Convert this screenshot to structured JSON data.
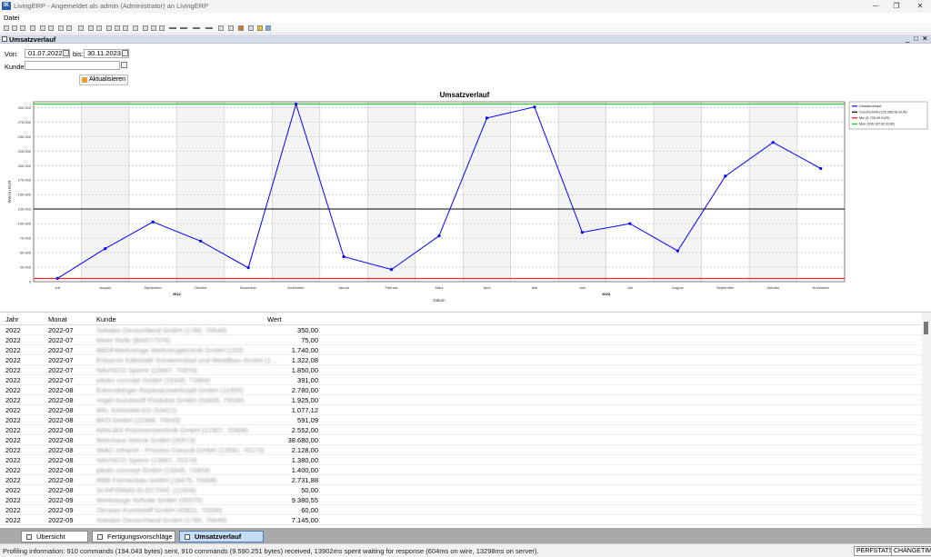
{
  "window": {
    "title": "LivingERP - Angemeldet als admin (Administrator) an LivingERP",
    "app_icon": "IK"
  },
  "menu": {
    "items": [
      "Datei"
    ]
  },
  "document": {
    "title": "Umsatzverlauf"
  },
  "filters": {
    "from_label": "Von:",
    "from_value": "01.07.2022",
    "to_label": "bis:",
    "to_value": "30.11.2023",
    "customer_label": "Kunde:",
    "customer_value": "",
    "refresh_label": "Aktualisieren"
  },
  "chart_data": {
    "type": "line",
    "title": "Umsatzverlauf",
    "ylabel": "Wert in EUR",
    "xlabel": "Datum",
    "ylim": [
      0,
      310000
    ],
    "yticks": [
      0,
      25000,
      50000,
      75000,
      100000,
      125000,
      150000,
      175000,
      200000,
      225000,
      250000,
      275000,
      300000
    ],
    "ytick_labels": [
      "0",
      "25.000",
      "50.000",
      "75.000",
      "100.000",
      "125.000",
      "150.000",
      "175.000",
      "200.000",
      "225.000",
      "250.000",
      "275.000",
      "300.000"
    ],
    "categories": [
      "Juli",
      "August",
      "September",
      "Oktober",
      "November",
      "Dezember",
      "Januar",
      "Februar",
      "März",
      "April",
      "Mai",
      "Juni",
      "Juli",
      "August",
      "September",
      "Oktober",
      "November"
    ],
    "year_labels": [
      {
        "label": "2022",
        "at": 2.5
      },
      {
        "label": "2023",
        "at": 11.5
      }
    ],
    "series": [
      {
        "name": "Umsatzverlauf",
        "color": "#0000ff",
        "values": [
          5700,
          57000,
          103000,
          70000,
          24000,
          306000,
          43000,
          21000,
          79000,
          282000,
          301000,
          85000,
          100000,
          53000,
          182000,
          240000,
          195000
        ]
      }
    ],
    "reference_lines": [
      {
        "name": "Durchschnitt (125.285,08 EUR)",
        "value": 125285.08,
        "color": "#000000"
      },
      {
        "name": "Min (5.728,09 EUR)",
        "value": 5728.09,
        "color": "#ff0000"
      },
      {
        "name": "Max (306.187,80 EUR)",
        "value": 306187.8,
        "color": "#00cc00"
      }
    ],
    "legend_position": "right",
    "grid": true
  },
  "table": {
    "columns": [
      "Jahr",
      "Monat",
      "Kunde",
      "Wert"
    ],
    "rows": [
      [
        "2022",
        "2022-07",
        "Sekalon Deutschland GmbH (1780, 70649)",
        "350,00"
      ],
      [
        "2022",
        "2022-07",
        "Meier Rolle (BHS77376)",
        "75,00"
      ],
      [
        "2022",
        "2022-07",
        "BBDFWerkzeuge Werkzeugtechnik GmbH (1105…",
        "1.740,00"
      ],
      [
        "2022",
        "2022-07",
        "Erbsenm Edelstahl Schwimmbad und Metallbau GmbH (1…",
        "1.322,08"
      ],
      [
        "2022",
        "2022-07",
        "NAVISCO Sperre (13847, 70374)",
        "1.850,00"
      ],
      [
        "2022",
        "2022-07",
        "pikatu concept GmbH (19345, 73454)",
        "391,00"
      ],
      [
        "2022",
        "2022-08",
        "Erkensberger Reparaturwerkstatt GmbH (11955)",
        "2.780,00"
      ],
      [
        "2022",
        "2022-08",
        "Vogel Kunststoff Produkte GmbH (53435, 79035)",
        "1.925,00"
      ],
      [
        "2022",
        "2022-08",
        "BRL KANAMA KG (53421)",
        "1.077,12"
      ],
      [
        "2022",
        "2022-08",
        "BKO GmbH (12396, 70045)",
        "591,09"
      ],
      [
        "2022",
        "2022-08",
        "NANJAS Präzisionstechnik GmbH (12307, 70458)",
        "2.552,00"
      ],
      [
        "2022",
        "2022-08",
        "Weinhaus Sterne GmbH (30573)",
        "38.680,00"
      ],
      [
        "2022",
        "2022-08",
        "IWAC Infranet - Process Consult GmbH (13581, 70173)",
        "2.128,00"
      ],
      [
        "2022",
        "2022-08",
        "NAVISCO Sperre (13847, 70374)",
        "1.380,00"
      ],
      [
        "2022",
        "2022-08",
        "pikatu concept GmbH (19345, 73454)",
        "1.400,00"
      ],
      [
        "2022",
        "2022-08",
        "RBB Formenbau GmbH (18475, 70068)",
        "2.731,88"
      ],
      [
        "2022",
        "2022-08",
        "SUNFORMS ELECTRIC (11504)",
        "50,00"
      ],
      [
        "2022",
        "2022-09",
        "Werkzeuge Schulte GmbH (30575)",
        "9.380,55"
      ],
      [
        "2022",
        "2022-09",
        "Zitrusan Kunststoff GmbH (43811, 70346)",
        "60,00"
      ],
      [
        "2022",
        "2022-09",
        "Sekalon Deutschland GmbH (1780, 70649)",
        "7.145,00"
      ]
    ]
  },
  "tabs": [
    {
      "label": "Übersicht",
      "active": false
    },
    {
      "label": "Fertigungsvorschläge",
      "active": false
    },
    {
      "label": "Umsatzverlauf",
      "active": true
    }
  ],
  "status": {
    "text": "Profiling information: 910 commands (194.043 bytes) sent, 910 commands (9.590.251 bytes) received, 13902ms spent waiting for response (604ms on wire, 13298ms on server).",
    "btn1": "PERFSTATS",
    "btn2": "CHANGETIME"
  }
}
